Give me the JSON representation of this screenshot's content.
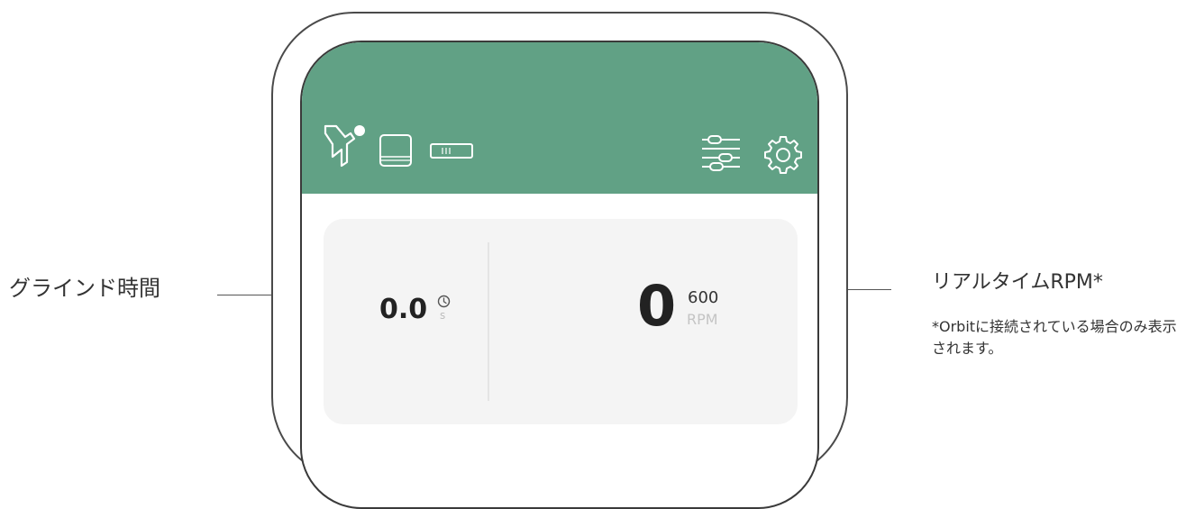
{
  "theme": {
    "accent": "#61a185",
    "card_bg": "#f4f4f4"
  },
  "header": {
    "left_icons": [
      "connection-status-icon",
      "tablet-icon",
      "battery-icon"
    ],
    "right_icons": [
      "sliders-icon",
      "gear-icon"
    ]
  },
  "card": {
    "grind_time": {
      "value": "0.0",
      "unit": "s",
      "icon": "clock-icon"
    },
    "rpm": {
      "value": "0",
      "target": "600",
      "unit": "RPM"
    }
  },
  "callouts": {
    "left": "グラインド時間",
    "right_title": "リアルタイムRPM*",
    "right_note": "*Orbitに接続されている場合のみ表示されます。"
  }
}
